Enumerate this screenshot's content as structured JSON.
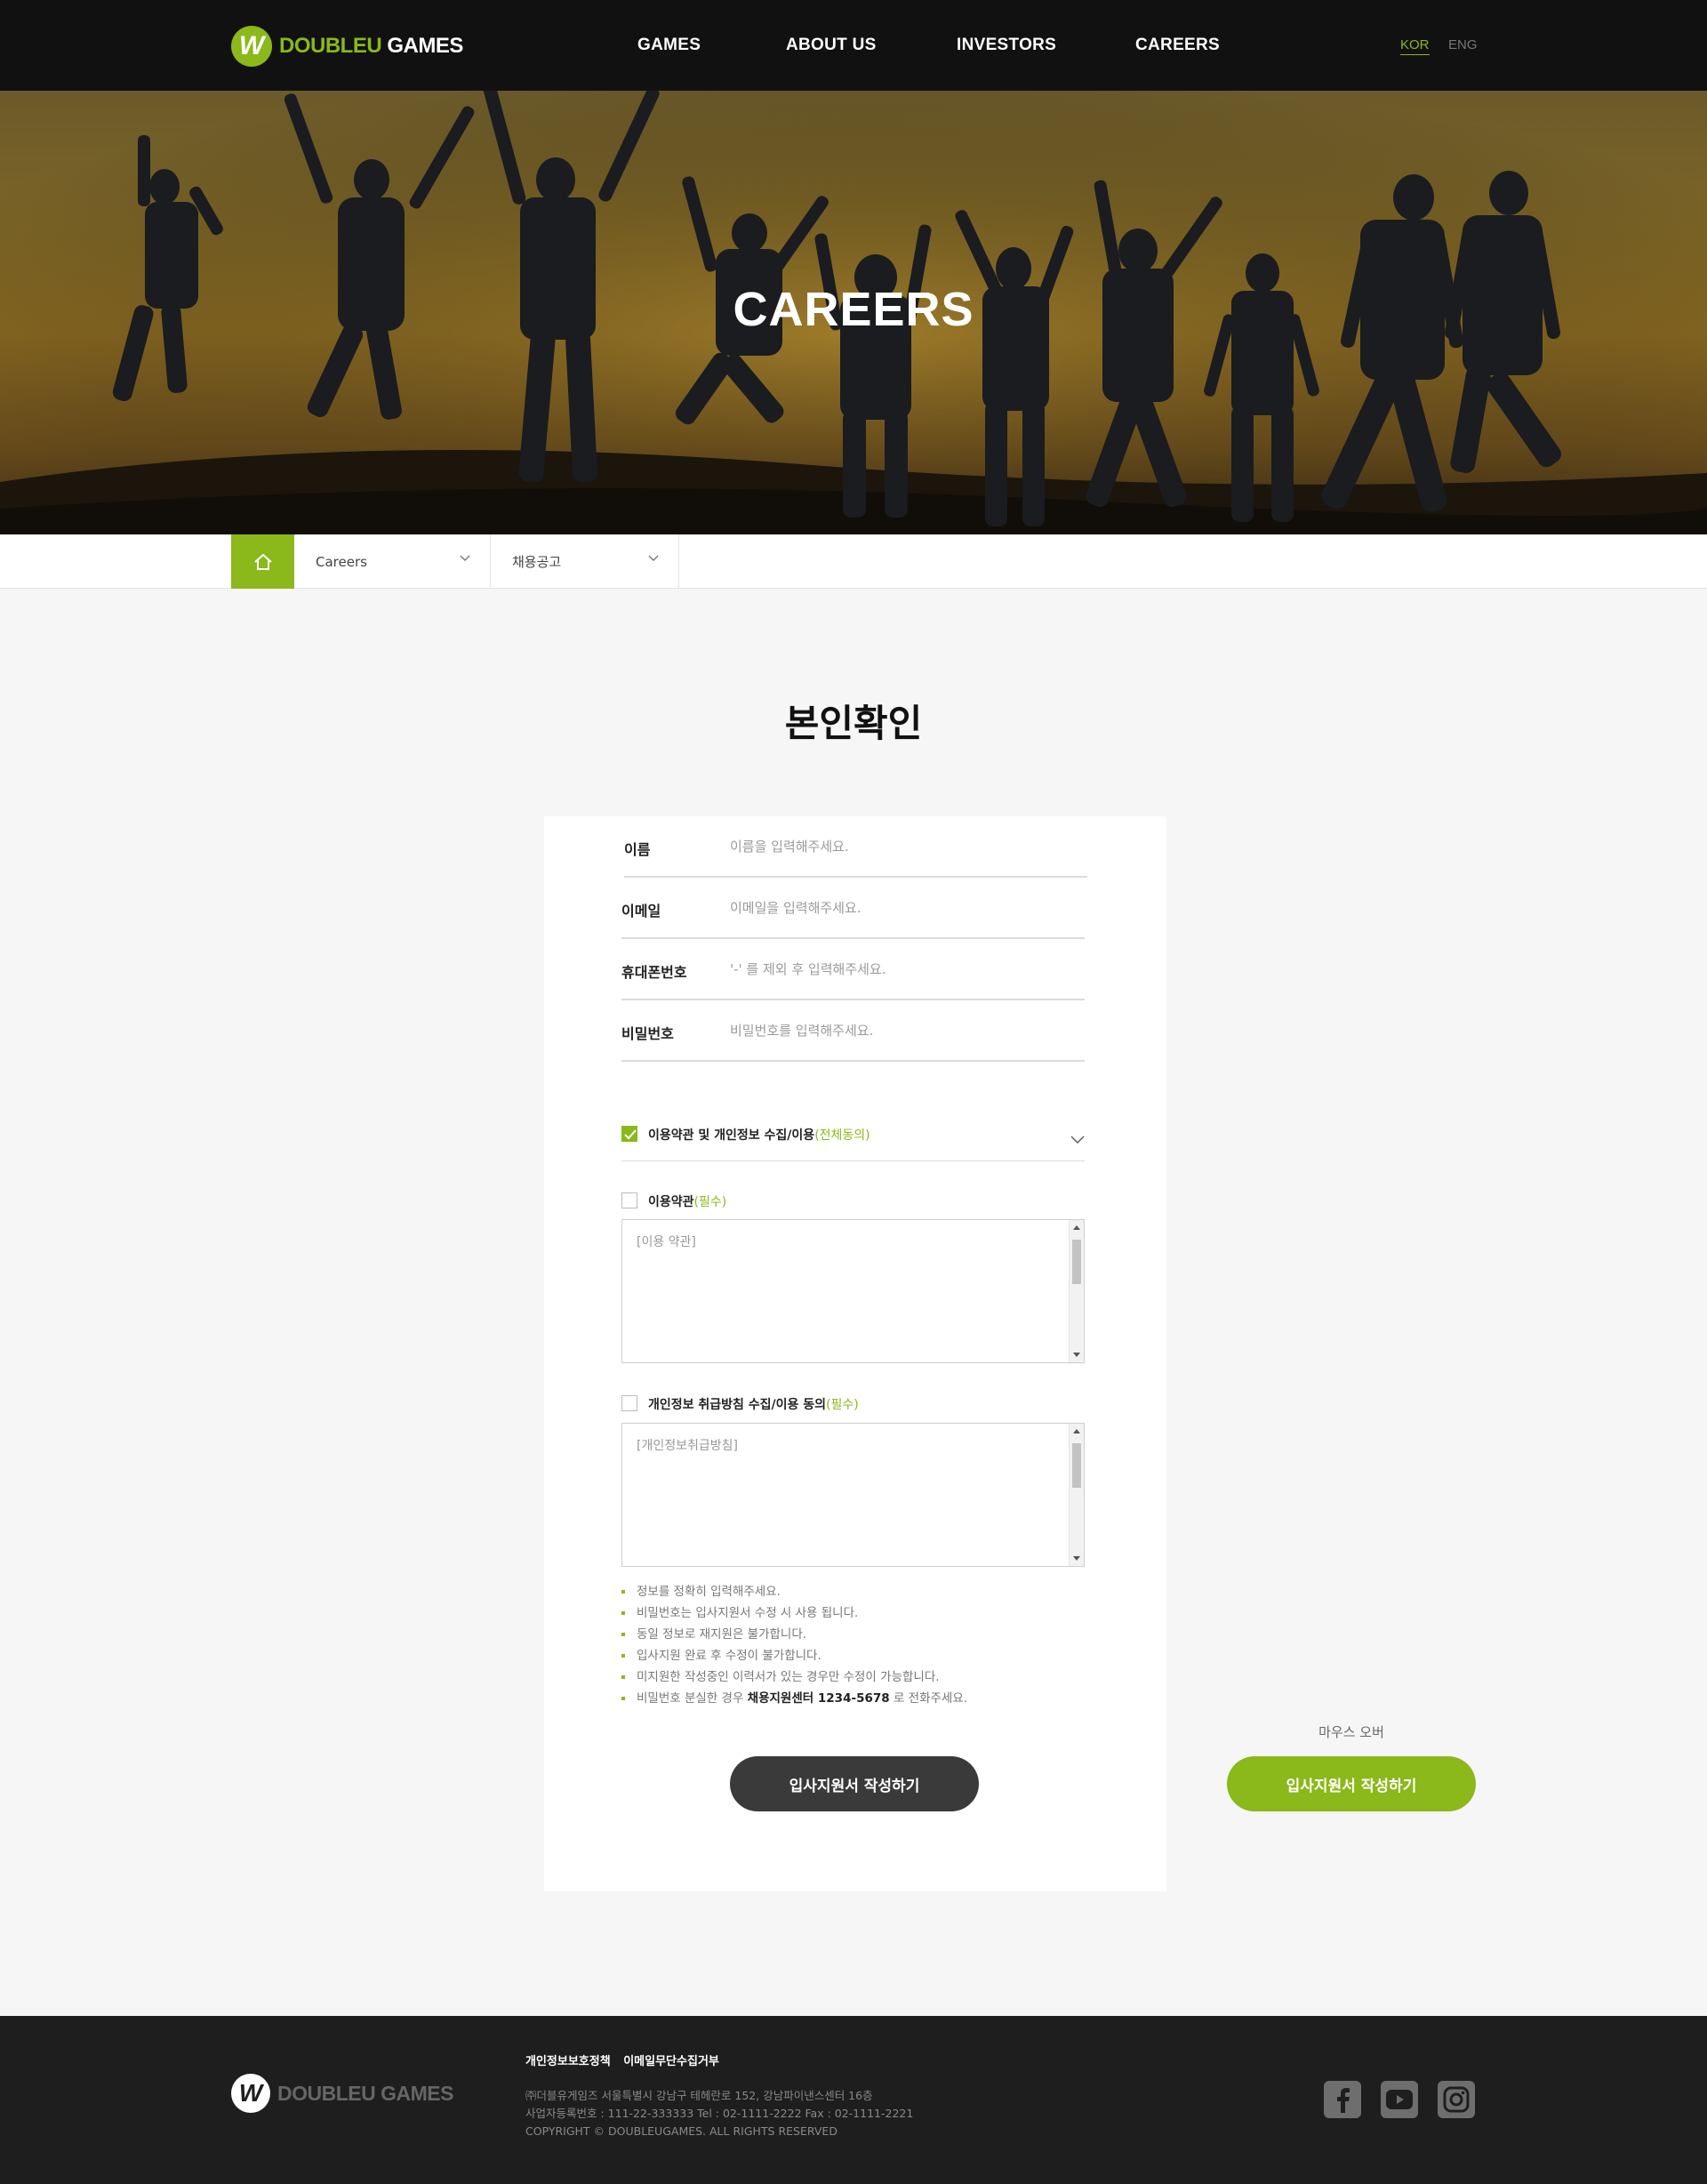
{
  "header": {
    "logo_primary": "DOUBLEU",
    "logo_secondary": "GAMES",
    "nav": [
      "GAMES",
      "ABOUT US",
      "INVESTORS",
      "CAREERS"
    ],
    "lang_kor": "KOR",
    "lang_eng": "ENG",
    "accent": "#8bb81a"
  },
  "hero": {
    "title": "CAREERS"
  },
  "breadcrumb": {
    "level1": "Careers",
    "level2": "채용공고"
  },
  "page": {
    "title": "본인확인"
  },
  "form": {
    "name": {
      "label": "이름",
      "placeholder": "이름을 입력해주세요."
    },
    "email": {
      "label": "이메일",
      "placeholder": "이메일을 입력해주세요."
    },
    "phone": {
      "label": "휴대폰번호",
      "placeholder": "'-' 를 제외 후 입력해주세요."
    },
    "password": {
      "label": "비밀번호",
      "placeholder": "비밀번호를 입력해주세요."
    }
  },
  "agreements": {
    "all": {
      "label": "이용약관 및 개인정보 수집/이용",
      "suffix": "(전체동의)",
      "checked": true
    },
    "terms": {
      "label": "이용약관",
      "suffix": "(필수)",
      "content": "[이용 약관]",
      "checked": false
    },
    "privacy": {
      "label": "개인정보 취급방침 수집/이용 동의",
      "suffix": "(필수)",
      "content": "[개인정보취급방침]",
      "checked": false
    }
  },
  "notes": [
    "정보를 정확히 입력해주세요.",
    "비밀번호는 입사지원서 수정 시 사용 됩니다.",
    "동일 정보로 재지원은 불가합니다.",
    "입사지원 완료 후 수정이 불가합니다.",
    "미지원한 작성중인 이력서가 있는 경우만 수정이 가능합니다."
  ],
  "note_last": {
    "prefix": "비밀번호 분실한 경우",
    "highlight": "채용지원센터 1234-5678",
    "suffix": "로 전화주세요."
  },
  "buttons": {
    "apply": "입사지원서 작성하기",
    "apply_hover": "입사지원서 작성하기",
    "hover_caption": "마우스 오버"
  },
  "footer": {
    "link_privacy": "개인정보보호정책",
    "link_email": "이메일무단수집거부",
    "line1": "㈜더블유게임즈    서울특별시 강남구 테헤란로 152, 강남파이낸스센터 16층",
    "line2": "사업자등록번호 : 111-22-333333    Tel : 02-1111-2222    Fax : 02-1111-2221",
    "copyright": "COPYRIGHT © DOUBLEUGAMES. ALL RIGHTS RESERVED",
    "social_icons": [
      "facebook-icon",
      "youtube-icon",
      "instagram-icon"
    ]
  }
}
